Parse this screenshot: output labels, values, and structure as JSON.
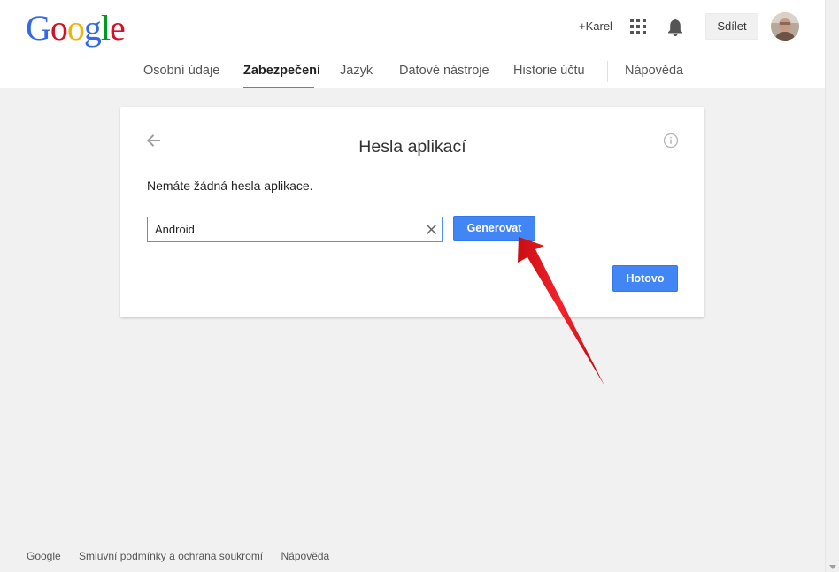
{
  "header": {
    "logo_letters": [
      {
        "ch": "G",
        "color": "#3369e8"
      },
      {
        "ch": "o",
        "color": "#d50f25"
      },
      {
        "ch": "o",
        "color": "#eeb211"
      },
      {
        "ch": "g",
        "color": "#3369e8"
      },
      {
        "ch": "l",
        "color": "#009925"
      },
      {
        "ch": "e",
        "color": "#d50f25"
      }
    ],
    "plus_user": "+Karel",
    "share_label": "Sdílet"
  },
  "nav": {
    "items": [
      {
        "label": "Osobní údaje",
        "active": false
      },
      {
        "label": "Zabezpečení",
        "active": true
      },
      {
        "label": "Jazyk",
        "active": false
      },
      {
        "label": "Datové nástroje",
        "active": false
      },
      {
        "label": "Historie účtu",
        "active": false
      },
      {
        "label": "Nápověda",
        "active": false
      }
    ]
  },
  "card": {
    "title": "Hesla aplikací",
    "message": "Nemáte žádná hesla aplikace.",
    "app_name_value": "Android",
    "generate_label": "Generovat",
    "done_label": "Hotovo"
  },
  "footer": {
    "links": [
      "Google",
      "Smluvní podmínky a ochrana soukromí",
      "Nápověda"
    ]
  },
  "colors": {
    "accent": "#4285f4",
    "annotation_arrow": "#e8141b"
  }
}
